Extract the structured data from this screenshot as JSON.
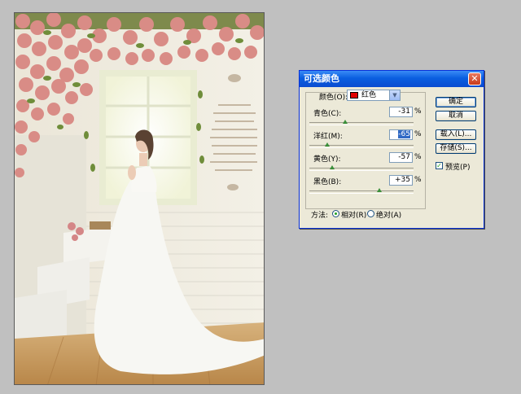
{
  "dialog": {
    "title": "可选颜色",
    "colors_label": "颜色(O):",
    "colors_value": "红色",
    "colors_swatch": "#e00000",
    "sliders": [
      {
        "label": "青色(C):",
        "value": "-31",
        "unit": "%",
        "pct": -31
      },
      {
        "label": "洋红(M):",
        "value": "-65",
        "unit": "%",
        "pct": -65,
        "selected": true
      },
      {
        "label": "黄色(Y):",
        "value": "-57",
        "unit": "%",
        "pct": -57
      },
      {
        "label": "黑色(B):",
        "value": "+35",
        "unit": "%",
        "pct": 35
      }
    ],
    "buttons": {
      "ok": "确定",
      "cancel": "取消",
      "load": "载入(L)...",
      "save": "存储(S)..."
    },
    "preview_label": "预览(P)",
    "preview_checked": true,
    "method_label": "方法:",
    "method_relative": "相对(R)",
    "method_absolute": "绝对(A)",
    "method_selected": "relative",
    "close_icon": "close-icon"
  }
}
